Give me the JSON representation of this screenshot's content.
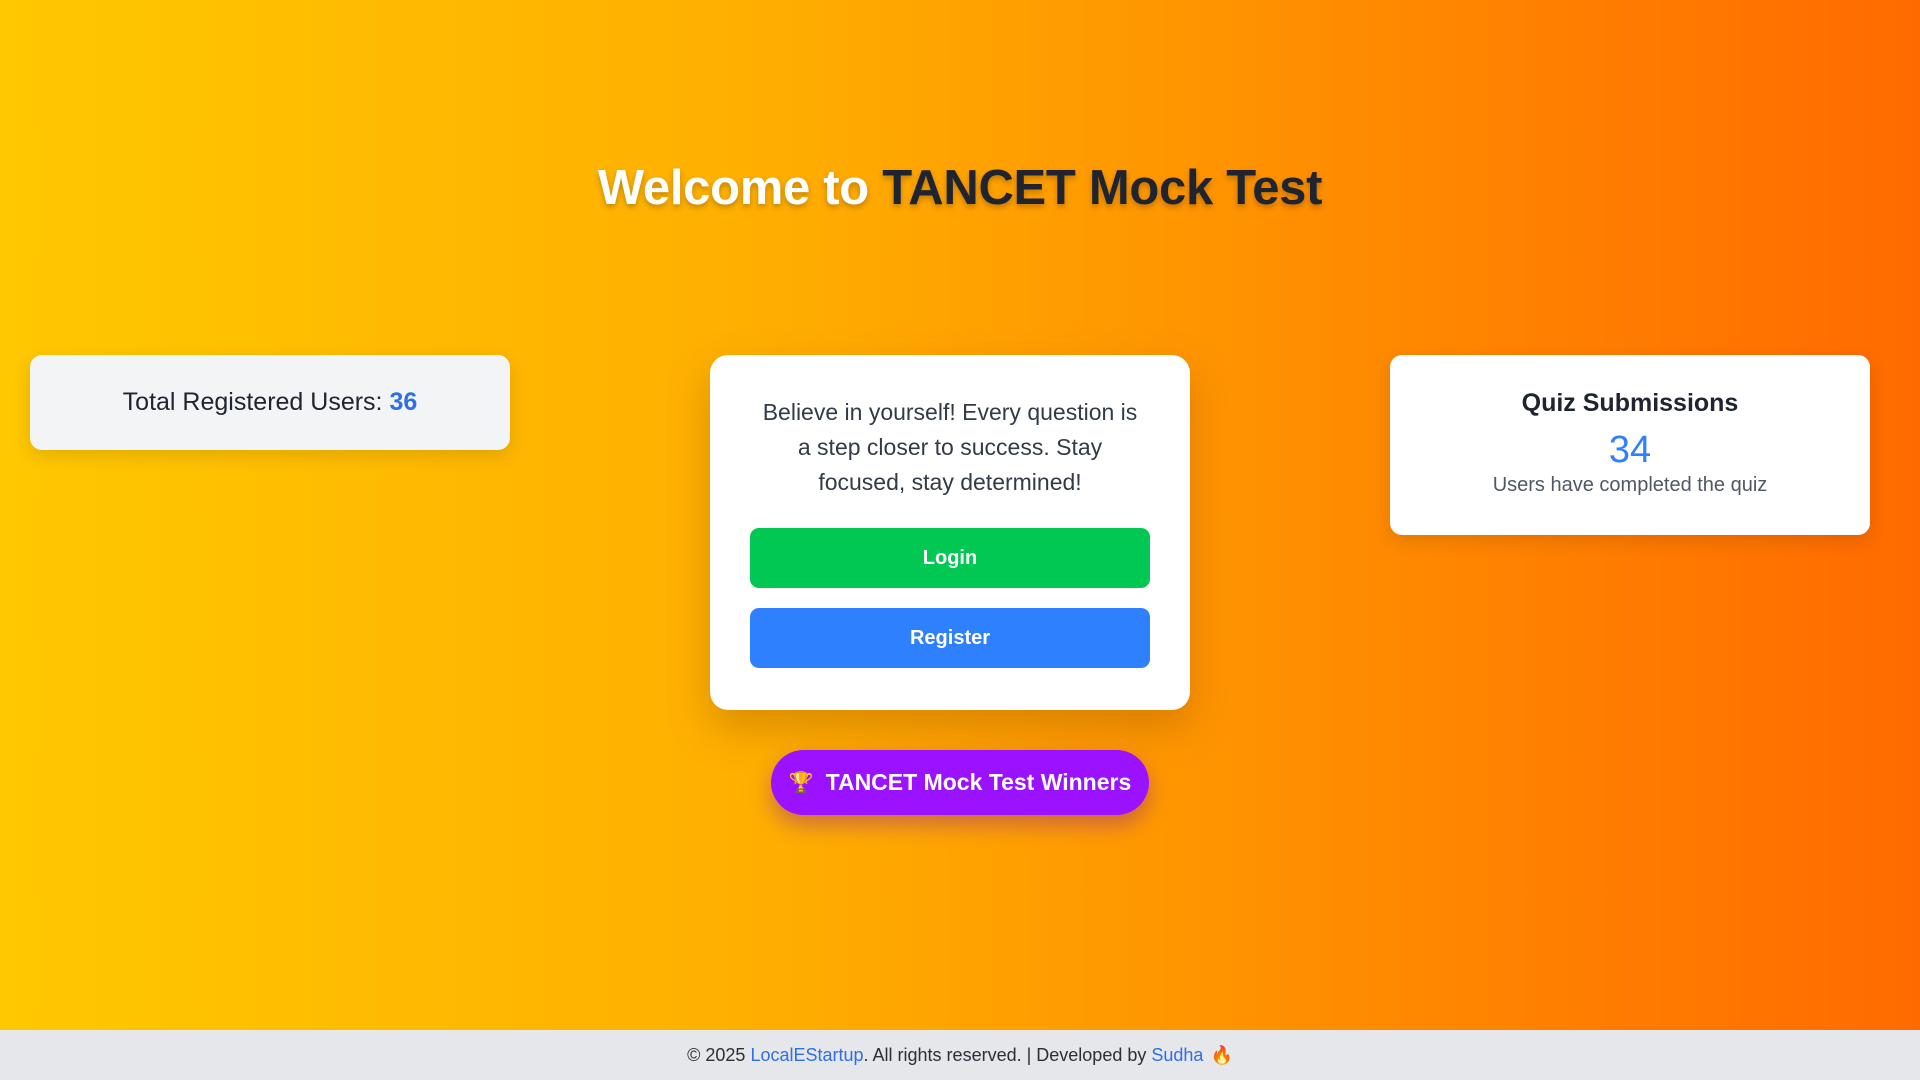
{
  "header": {
    "title_part1": "Welcome to",
    "title_part2": "TANCET Mock Test"
  },
  "stats": {
    "registered_label": "Total Registered Users:",
    "registered_count": "36"
  },
  "main_card": {
    "motivation": "Believe in yourself! Every question is a step closer to success. Stay focused, stay determined!",
    "login_label": "Login",
    "register_label": "Register"
  },
  "quiz": {
    "title": "Quiz Submissions",
    "count": "34",
    "subtitle": "Users have completed the quiz"
  },
  "winners": {
    "label": "TANCET Mock Test Winners",
    "icon": "trophy-icon"
  },
  "footer": {
    "copyright": "© 2025",
    "company": "LocalEStartup",
    "rights": ". All rights reserved. | Developed by",
    "developer": "Sudha",
    "icon": "fire-icon"
  },
  "colors": {
    "accent_blue": "#2f80ff",
    "login_green": "#00c853",
    "winners_purple": "#9a12ff",
    "gradient_start": "#ffc800",
    "gradient_end": "#ff6a00"
  }
}
